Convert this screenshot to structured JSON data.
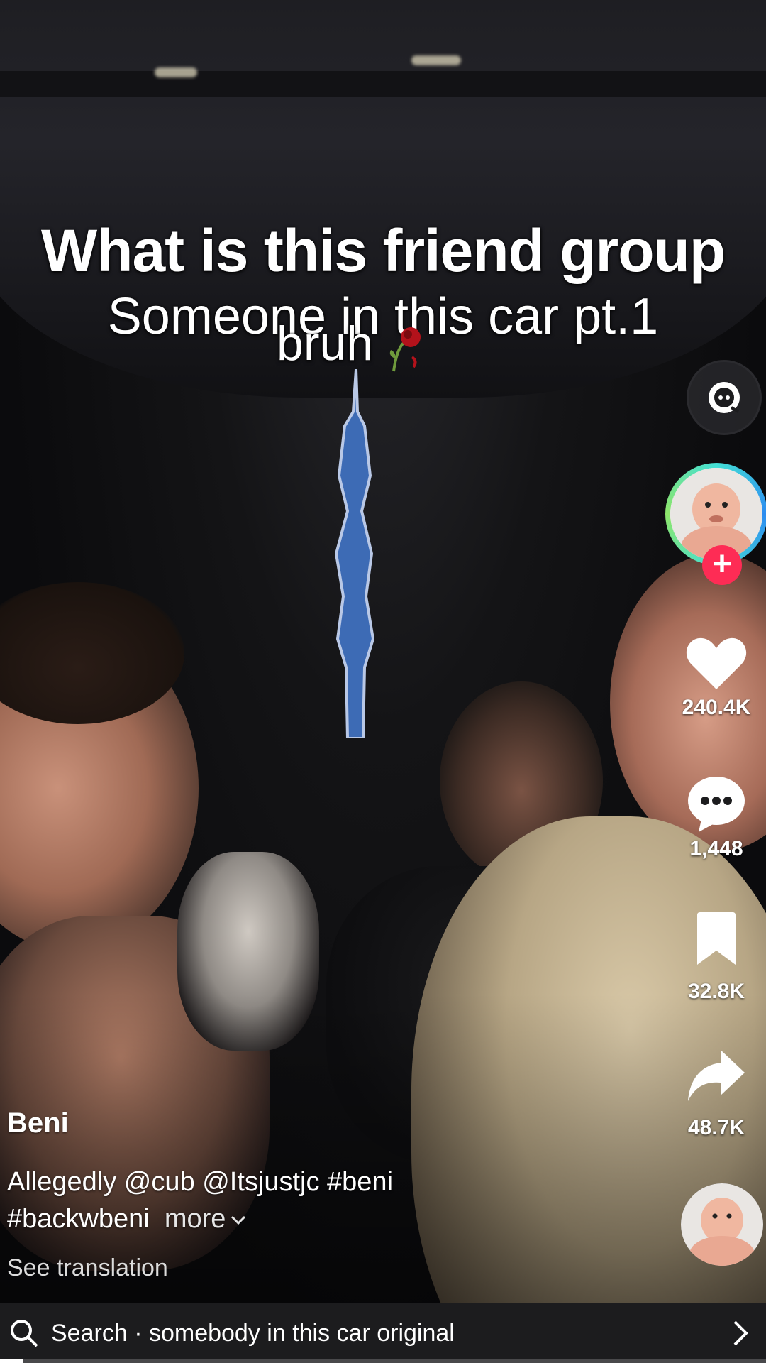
{
  "overlay_text": {
    "line1": "What is this friend group",
    "line2": "Someone in this car pt.1",
    "line3": "bruh"
  },
  "rail": {
    "likes": "240.4K",
    "comments": "1,448",
    "saves": "32.8K",
    "shares": "48.7K"
  },
  "post": {
    "author": "Beni",
    "caption_prefix": "Allegedly",
    "mention1": "@cub",
    "mention2": "@Itsjustjc",
    "hashtag1": "#beni",
    "hashtag2": "#backwbeni",
    "more": "more",
    "see_translation": "See translation"
  },
  "search": {
    "label": "Search",
    "separator": "·",
    "query": "somebody in this car original"
  },
  "progress": 0.03
}
